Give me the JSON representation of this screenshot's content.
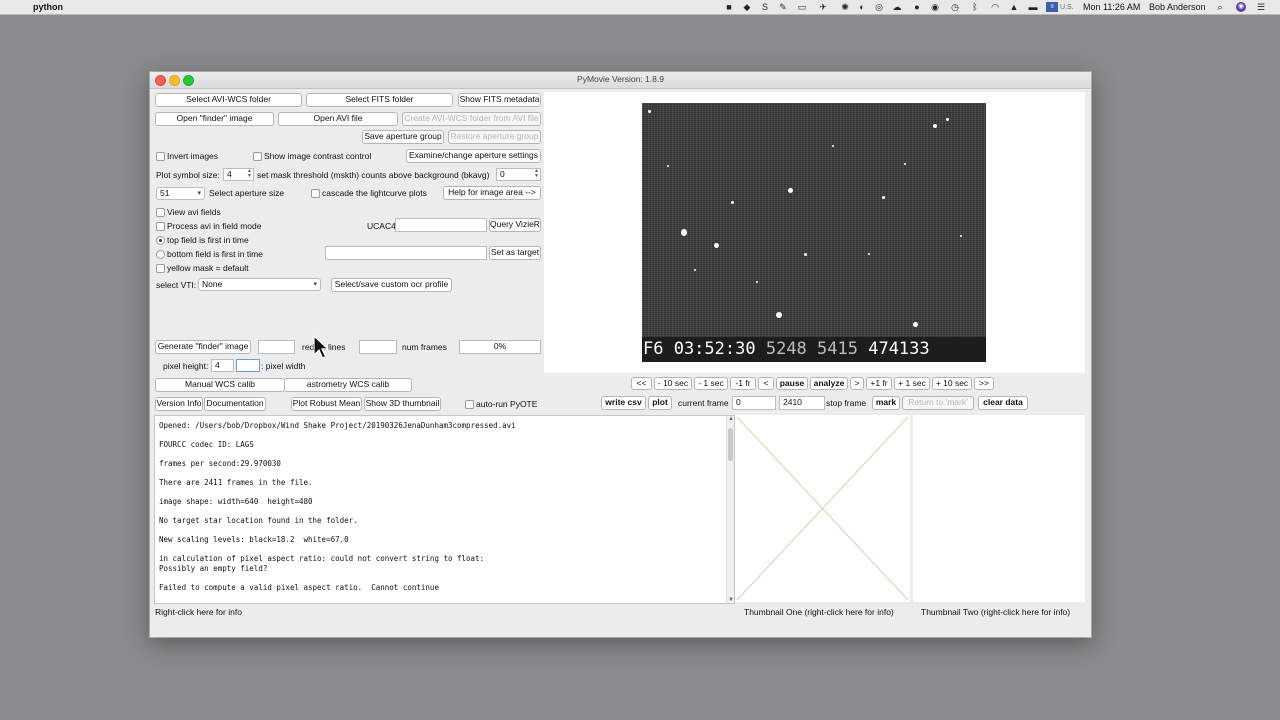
{
  "menubar": {
    "app_name": "python",
    "clock": "Mon 11:26 AM",
    "user": "Bob Anderson",
    "input_source": "U.S."
  },
  "window": {
    "title": "PyMovie  Version: 1.8.9"
  },
  "buttons": {
    "select_avi_wcs": "Select AVI-WCS folder",
    "select_fits": "Select FITS folder",
    "show_fits_meta": "Show FITS metadata",
    "open_finder": "Open \"finder\" image",
    "open_avi": "Open AVI file",
    "create_avi_wcs": "Create AVI-WCS folder from AVI file",
    "save_aperture": "Save aperture group",
    "restore_aperture": "Restore aperture group",
    "examine_aperture": "Examine/change aperture settings",
    "help_image_area": "Help for image area -->",
    "query_vizier": "Query VizieR",
    "set_target": "Set as target",
    "select_ocr": "Select/save custom ocr profile",
    "generate_finder": "Generate \"finder\" image",
    "manual_wcs": "Manual WCS calib",
    "astrometry_wcs": "astrometry WCS calib",
    "version_info": "Version Info",
    "documentation": "Documentation",
    "plot_robust": "Plot Robust Mean",
    "show_3d": "Show 3D thumbnail",
    "write_csv": "write csv",
    "plot": "plot",
    "mark": "mark",
    "return_mark": "Return to 'mark'",
    "clear_data": "clear data"
  },
  "checks": {
    "invert": "Invert images",
    "contrast": "Show image contrast control",
    "cascade": "cascade the lightcurve plots",
    "view_fields": "View avi fields",
    "field_mode": "Process avi in field mode",
    "auto_pyote": "auto-run PyOTE",
    "yellow_mask": "yellow mask = default"
  },
  "radios": {
    "top_first": "top field is first in time",
    "bottom_first": "bottom field is first in time"
  },
  "labels": {
    "plot_symbol": "Plot symbol size:",
    "plot_symbol_val": "4",
    "mask_threshold": "set mask threshold (mskth) counts above background (bkavg)",
    "mask_threshold_val": "0",
    "aperture_val": "51",
    "aperture_size": "Select aperture size",
    "ucac4": "UCAC4",
    "select_vti": "select VTI:",
    "vti_value": "None",
    "redact_lines": "redact lines",
    "num_frames": "num frames",
    "progress": "0%",
    "pixel_height": "pixel height:",
    "pixel_height_val": "4",
    "pixel_width": ": pixel width",
    "current_frame": "current frame",
    "current_frame_val": "0",
    "stop_frame_val": "2410",
    "stop_frame": "stop frame",
    "status": "Right-click here for info",
    "thumb1": "Thumbnail One (right-click here for info)",
    "thumb2": "Thumbnail Two (right-click here for info)"
  },
  "nav": [
    "<<",
    "- 10 sec",
    "- 1 sec",
    "-1 fr",
    "<",
    "pause",
    "analyze",
    ">",
    "+1 fr",
    "+ 1 sec",
    "+ 10 sec",
    ">>"
  ],
  "video": {
    "ts_a": "F6 03:52:30",
    "ts_b": "5248 5415",
    "ts_c": "474133"
  },
  "log": [
    "Opened: /Users/bob/Dropbox/Wind Shake Project/20190326JenaDunham3compressed.avi",
    "",
    "FOURCC codec ID: LAGS",
    "",
    "frames per second:29.970030",
    "",
    "There are 2411 frames in the file.",
    "",
    "image shape: width=640  height=480",
    "",
    "No target star location found in the folder.",
    "",
    "New scaling levels: black=18.2  white=67.0",
    "",
    "in calculation of pixel aspect ratio: could not convert string to float:",
    "Possibly an empty field?",
    "",
    "Failed to compute a valid pixel aspect ratio.  Cannot continue"
  ]
}
